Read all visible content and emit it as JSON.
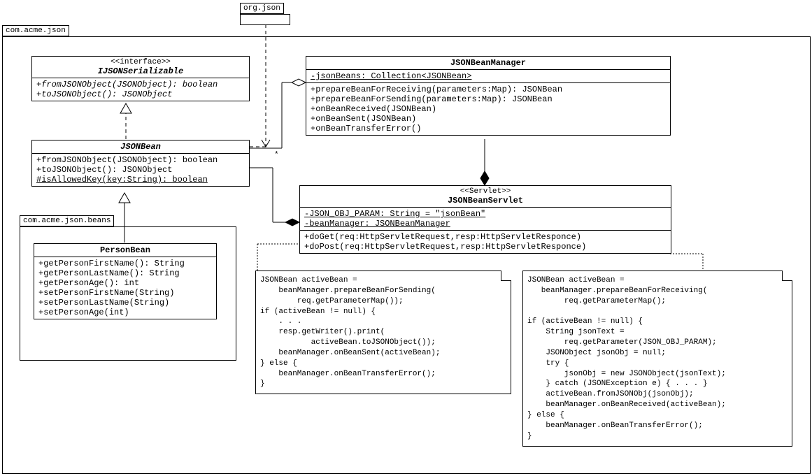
{
  "packages": {
    "orgjson": "org.json",
    "acme": "com.acme.json",
    "beans": "com.acme.json.beans"
  },
  "ijson": {
    "stereo": "<<interface>>",
    "name": "IJSONSerializable",
    "ops": {
      "fromJSON": "+fromJSONObject(JSONObject): boolean",
      "toJSON": "+toJSONObject(): JSONObject"
    }
  },
  "jsonbean": {
    "name": "JSONBean",
    "ops": {
      "fromJSON": "+fromJSONObject(JSONObject): boolean",
      "toJSON": "+toJSONObject(): JSONObject",
      "isAllowed": "#isAllowedKey(key:String): boolean"
    }
  },
  "person": {
    "name": "PersonBean",
    "ops": {
      "getFirst": "+getPersonFirstName(): String",
      "getLast": "+getPersonLastName(): String",
      "getAge": "+getPersonAge(): int",
      "setFirst": "+setPersonFirstName(String)",
      "setLast": "+setPersonLastName(String)",
      "setAge": "+setPersonAge(int)"
    }
  },
  "manager": {
    "name": "JSONBeanManager",
    "attrs": {
      "jsonBeans": "-jsonBeans: Collection<JSONBean>"
    },
    "ops": {
      "prepRecv": "+prepareBeanForReceiving(parameters:Map): JSONBean",
      "prepSend": "+prepareBeanForSending(parameters:Map): JSONBean",
      "onRecv": "+onBeanReceived(JSONBean)",
      "onSent": "+onBeanSent(JSONBean)",
      "onErr": "+onBeanTransferError()"
    }
  },
  "servlet": {
    "stereo": "<<Servlet>>",
    "name": "JSONBeanServlet",
    "attrs": {
      "param": "-JSON_OBJ_PARAM: String = \"jsonBean\"",
      "mgr": "-beanManager: JSONBeanManager"
    },
    "ops": {
      "doGet": "+doGet(req:HttpServletRequest,resp:HttpServletResponce)",
      "doPost": "+doPost(req:HttpServletRequest,resp:HttpServletResponce)"
    }
  },
  "mult": {
    "star": "*"
  },
  "note1": "JSONBean activeBean =\n    beanManager.prepareBeanForSending(\n        req.getParameterMap());\nif (activeBean != null) {\n    . . .\n    resp.getWriter().print(\n           activeBean.toJSONObject());\n    beanManager.onBeanSent(activeBean);\n} else {\n    beanManager.onBeanTransferError();\n}",
  "note2": "JSONBean activeBean =\n   beanManager.prepareBeanForReceiving(\n        req.getParameterMap();\n\nif (activeBean != null) {\n    String jsonText =\n        req.getParameter(JSON_OBJ_PARAM);\n    JSONObject jsonObj = null;\n    try {\n        jsonObj = new JSONObject(jsonText);\n    } catch (JSONException e) { . . . }\n    activeBean.fromJSONObj(jsonObj);\n    beanManager.onBeanReceived(activeBean);\n} else {\n    beanManager.onBeanTransferError();\n}"
}
